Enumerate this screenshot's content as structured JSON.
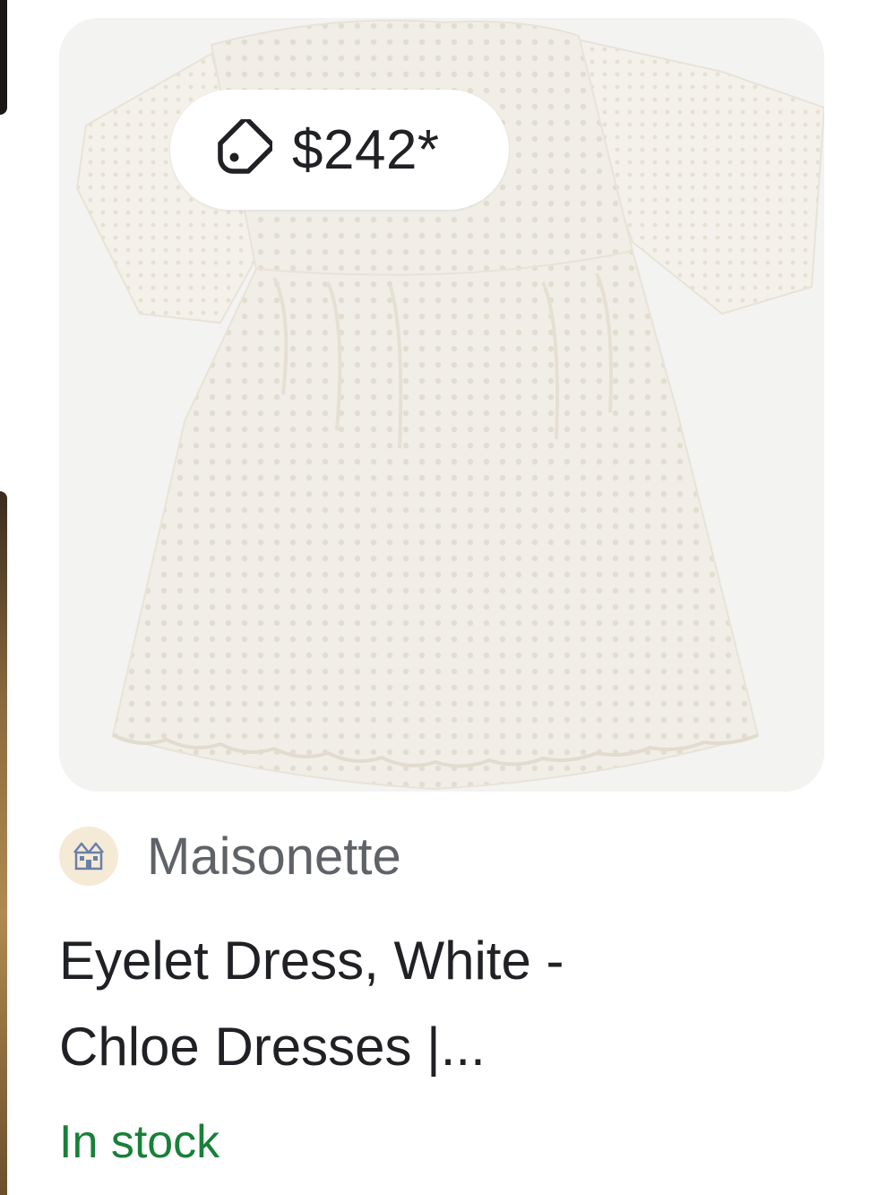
{
  "product": {
    "price": "$242*",
    "merchant": "Maisonette",
    "title_line1": "Eyelet Dress, White -",
    "title_line2": "Chloe Dresses |...",
    "availability": "In stock"
  },
  "icons": {
    "price_tag": "tag-icon",
    "merchant_logo": "house-logo-icon"
  },
  "colors": {
    "availability": "#188038",
    "merchant_text": "#5f6368",
    "title_text": "#202124",
    "image_background": "#f3f3f1"
  }
}
